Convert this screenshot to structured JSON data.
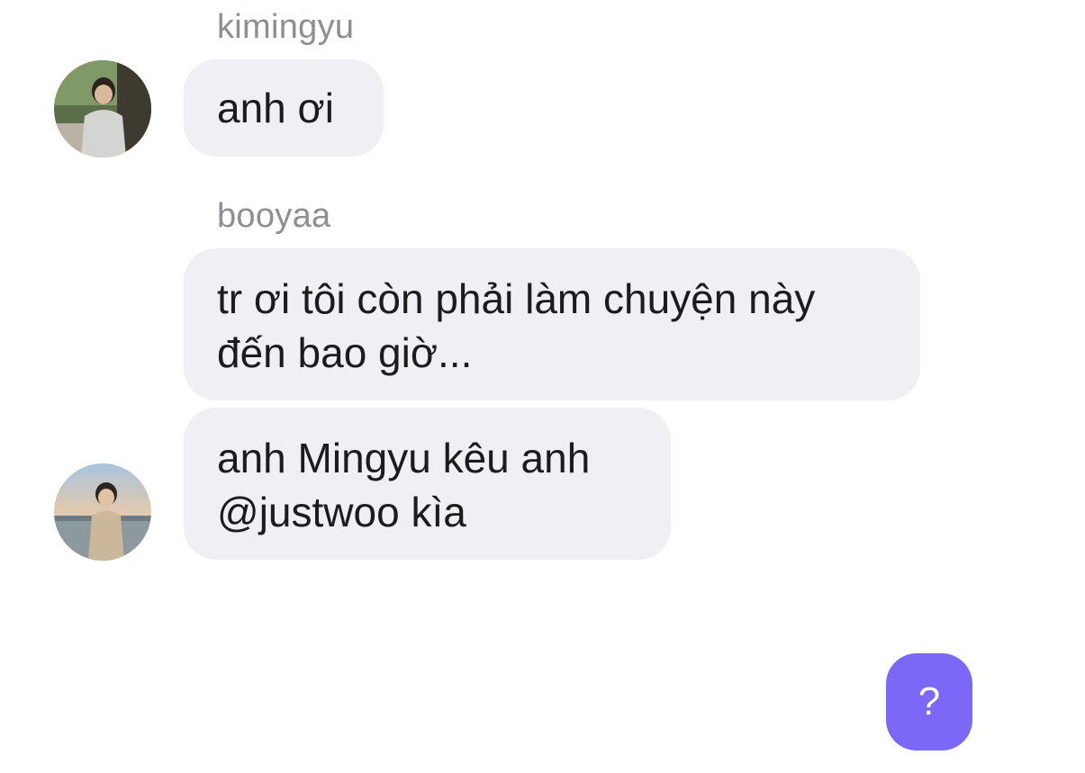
{
  "messages": [
    {
      "sender": "kimingyu",
      "text": "anh ơi"
    },
    {
      "sender": "booyaa",
      "text": "tr ơi tôi còn phải làm chuyện này\nđến bao giờ..."
    },
    {
      "sender": "",
      "text": "anh Mingyu kêu anh\n@justwoo kìa"
    }
  ],
  "help_button": {
    "label": "?"
  },
  "colors": {
    "bubble": "#efeff4",
    "sender": "#8e8e93",
    "accent": "#7b68f6"
  }
}
